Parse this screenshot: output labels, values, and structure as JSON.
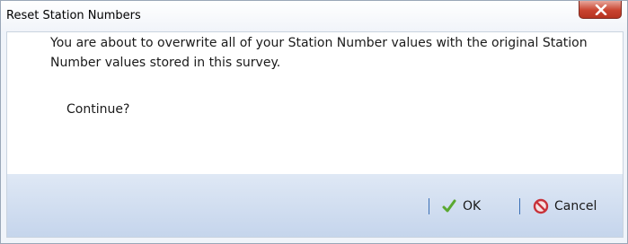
{
  "dialog": {
    "title": "Reset Station Numbers",
    "message": "You are about to overwrite all of your Station Number values with the original Station Number values stored in this survey.",
    "question": "Continue?",
    "ok_label": "OK",
    "cancel_label": "Cancel"
  },
  "icons": {
    "close": "close-icon",
    "ok": "check-icon",
    "cancel": "cancel-icon"
  },
  "colors": {
    "close_button": "#c9442f",
    "check": "#5aa830",
    "cancel": "#c8323a",
    "separator": "#3a6fb5"
  }
}
